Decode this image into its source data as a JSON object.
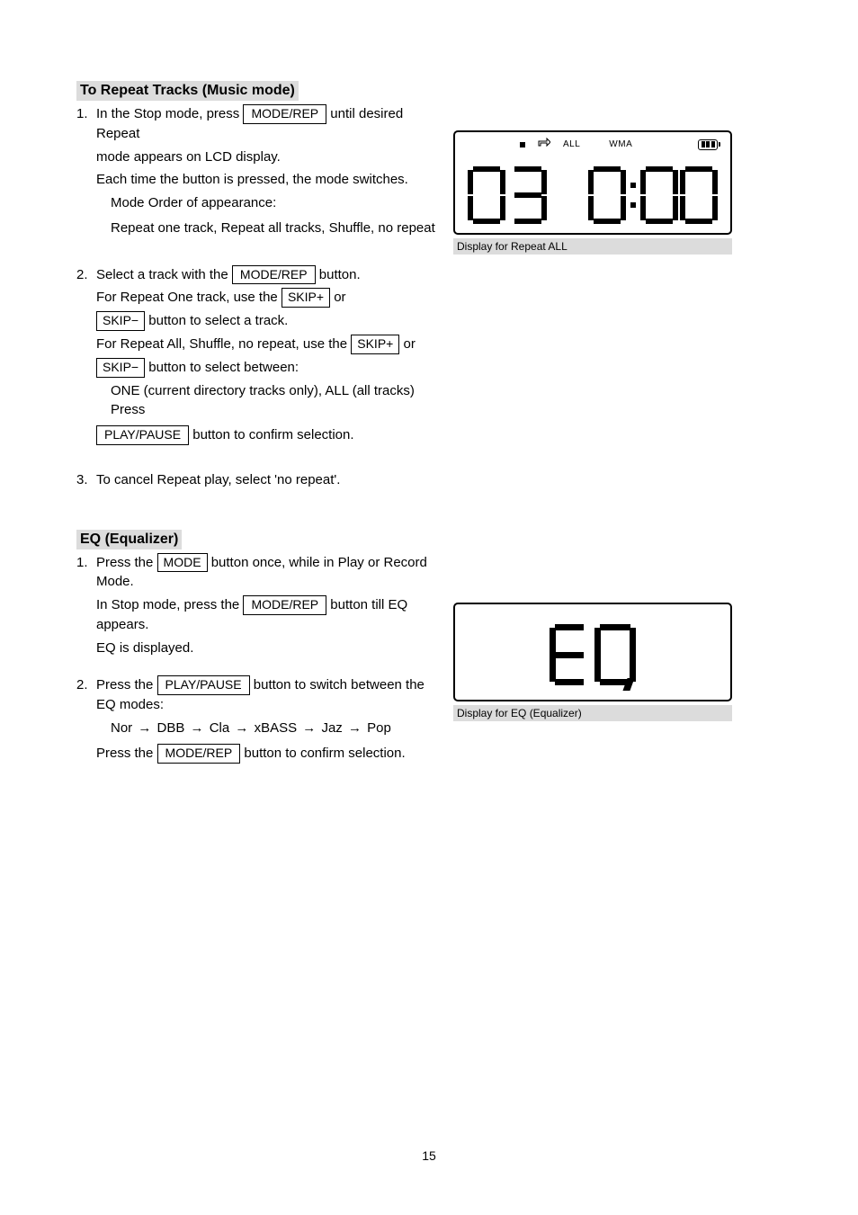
{
  "page_number": "15",
  "section_repeat": {
    "title": "To Repeat Tracks (Music mode)",
    "step1": {
      "prefix": "In the Stop mode, press ",
      "button": "MODE/REP",
      "suffix_line1": " until desired Repeat",
      "line2": "mode appears on LCD display.",
      "line3": "Each time the button is pressed, the mode switches.",
      "mode_order_label": "Mode Order of appearance: ",
      "mode_order_line": "Repeat one track, Repeat all tracks, Shuffle, no repeat"
    },
    "step2": {
      "prefix": "Select a track with the ",
      "button": "MODE/REP",
      "mid_text": " button.",
      "rep_one_line1": "For Repeat One track, use the ",
      "skip_fwd": "SKIP+",
      "or": " or ",
      "skip_back": "SKIP−",
      "rep_one_line2": " button to select a track.",
      "rep_all_line1": "For Repeat All, Shuffle, no repeat, use the ",
      "rep_all_line2": " button to select between:",
      "indent_line": "ONE (current directory tracks only), ALL (all tracks) Press ",
      "play_button": "PLAY/PAUSE",
      "indent_line_suffix": " button to confirm selection."
    },
    "step3": "To cancel Repeat play, select 'no repeat'."
  },
  "figure1_caption": "Display for Repeat ALL",
  "lcd1": {
    "stop": true,
    "loop": true,
    "all_label": "ALL",
    "wma_label": "WMA",
    "track": "03",
    "time": "0:00"
  },
  "section_eq": {
    "title": "EQ (Equalizer)",
    "step1": {
      "prefix": "Press the ",
      "button_mode": "MODE",
      "mid1": " button once, while in Play or Record Mode.",
      "line2_pre": "In Stop mode, press the ",
      "button_mode_rep": "MODE/REP",
      "line2_suf": " button till EQ appears.",
      "line3": "EQ is displayed."
    },
    "step2": {
      "prefix": "Press the ",
      "button_play": "PLAY/PAUSE",
      "suffix": " button to switch between the EQ modes:",
      "modes": [
        "Nor",
        "DBB",
        "Cla",
        "xBASS",
        "Jaz",
        "Pop"
      ],
      "line3_pre": "Press the ",
      "button_mode_rep": "MODE/REP",
      "line3_suf": " button to confirm selection."
    }
  },
  "figure2_caption": "Display for EQ (Equalizer)",
  "lcd2": {
    "text": "EQ"
  }
}
